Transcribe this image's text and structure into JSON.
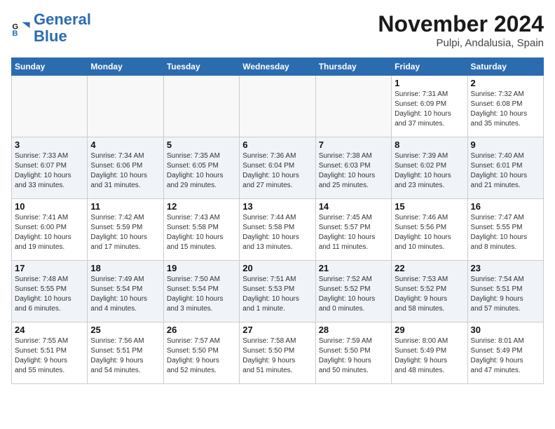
{
  "header": {
    "logo_general": "General",
    "logo_blue": "Blue",
    "month_title": "November 2024",
    "location": "Pulpi, Andalusia, Spain"
  },
  "weekdays": [
    "Sunday",
    "Monday",
    "Tuesday",
    "Wednesday",
    "Thursday",
    "Friday",
    "Saturday"
  ],
  "weeks": [
    [
      {
        "day": "",
        "info": ""
      },
      {
        "day": "",
        "info": ""
      },
      {
        "day": "",
        "info": ""
      },
      {
        "day": "",
        "info": ""
      },
      {
        "day": "",
        "info": ""
      },
      {
        "day": "1",
        "info": "Sunrise: 7:31 AM\nSunset: 6:09 PM\nDaylight: 10 hours\nand 37 minutes."
      },
      {
        "day": "2",
        "info": "Sunrise: 7:32 AM\nSunset: 6:08 PM\nDaylight: 10 hours\nand 35 minutes."
      }
    ],
    [
      {
        "day": "3",
        "info": "Sunrise: 7:33 AM\nSunset: 6:07 PM\nDaylight: 10 hours\nand 33 minutes."
      },
      {
        "day": "4",
        "info": "Sunrise: 7:34 AM\nSunset: 6:06 PM\nDaylight: 10 hours\nand 31 minutes."
      },
      {
        "day": "5",
        "info": "Sunrise: 7:35 AM\nSunset: 6:05 PM\nDaylight: 10 hours\nand 29 minutes."
      },
      {
        "day": "6",
        "info": "Sunrise: 7:36 AM\nSunset: 6:04 PM\nDaylight: 10 hours\nand 27 minutes."
      },
      {
        "day": "7",
        "info": "Sunrise: 7:38 AM\nSunset: 6:03 PM\nDaylight: 10 hours\nand 25 minutes."
      },
      {
        "day": "8",
        "info": "Sunrise: 7:39 AM\nSunset: 6:02 PM\nDaylight: 10 hours\nand 23 minutes."
      },
      {
        "day": "9",
        "info": "Sunrise: 7:40 AM\nSunset: 6:01 PM\nDaylight: 10 hours\nand 21 minutes."
      }
    ],
    [
      {
        "day": "10",
        "info": "Sunrise: 7:41 AM\nSunset: 6:00 PM\nDaylight: 10 hours\nand 19 minutes."
      },
      {
        "day": "11",
        "info": "Sunrise: 7:42 AM\nSunset: 5:59 PM\nDaylight: 10 hours\nand 17 minutes."
      },
      {
        "day": "12",
        "info": "Sunrise: 7:43 AM\nSunset: 5:58 PM\nDaylight: 10 hours\nand 15 minutes."
      },
      {
        "day": "13",
        "info": "Sunrise: 7:44 AM\nSunset: 5:58 PM\nDaylight: 10 hours\nand 13 minutes."
      },
      {
        "day": "14",
        "info": "Sunrise: 7:45 AM\nSunset: 5:57 PM\nDaylight: 10 hours\nand 11 minutes."
      },
      {
        "day": "15",
        "info": "Sunrise: 7:46 AM\nSunset: 5:56 PM\nDaylight: 10 hours\nand 10 minutes."
      },
      {
        "day": "16",
        "info": "Sunrise: 7:47 AM\nSunset: 5:55 PM\nDaylight: 10 hours\nand 8 minutes."
      }
    ],
    [
      {
        "day": "17",
        "info": "Sunrise: 7:48 AM\nSunset: 5:55 PM\nDaylight: 10 hours\nand 6 minutes."
      },
      {
        "day": "18",
        "info": "Sunrise: 7:49 AM\nSunset: 5:54 PM\nDaylight: 10 hours\nand 4 minutes."
      },
      {
        "day": "19",
        "info": "Sunrise: 7:50 AM\nSunset: 5:54 PM\nDaylight: 10 hours\nand 3 minutes."
      },
      {
        "day": "20",
        "info": "Sunrise: 7:51 AM\nSunset: 5:53 PM\nDaylight: 10 hours\nand 1 minute."
      },
      {
        "day": "21",
        "info": "Sunrise: 7:52 AM\nSunset: 5:52 PM\nDaylight: 10 hours\nand 0 minutes."
      },
      {
        "day": "22",
        "info": "Sunrise: 7:53 AM\nSunset: 5:52 PM\nDaylight: 9 hours\nand 58 minutes."
      },
      {
        "day": "23",
        "info": "Sunrise: 7:54 AM\nSunset: 5:51 PM\nDaylight: 9 hours\nand 57 minutes."
      }
    ],
    [
      {
        "day": "24",
        "info": "Sunrise: 7:55 AM\nSunset: 5:51 PM\nDaylight: 9 hours\nand 55 minutes."
      },
      {
        "day": "25",
        "info": "Sunrise: 7:56 AM\nSunset: 5:51 PM\nDaylight: 9 hours\nand 54 minutes."
      },
      {
        "day": "26",
        "info": "Sunrise: 7:57 AM\nSunset: 5:50 PM\nDaylight: 9 hours\nand 52 minutes."
      },
      {
        "day": "27",
        "info": "Sunrise: 7:58 AM\nSunset: 5:50 PM\nDaylight: 9 hours\nand 51 minutes."
      },
      {
        "day": "28",
        "info": "Sunrise: 7:59 AM\nSunset: 5:50 PM\nDaylight: 9 hours\nand 50 minutes."
      },
      {
        "day": "29",
        "info": "Sunrise: 8:00 AM\nSunset: 5:49 PM\nDaylight: 9 hours\nand 48 minutes."
      },
      {
        "day": "30",
        "info": "Sunrise: 8:01 AM\nSunset: 5:49 PM\nDaylight: 9 hours\nand 47 minutes."
      }
    ]
  ]
}
